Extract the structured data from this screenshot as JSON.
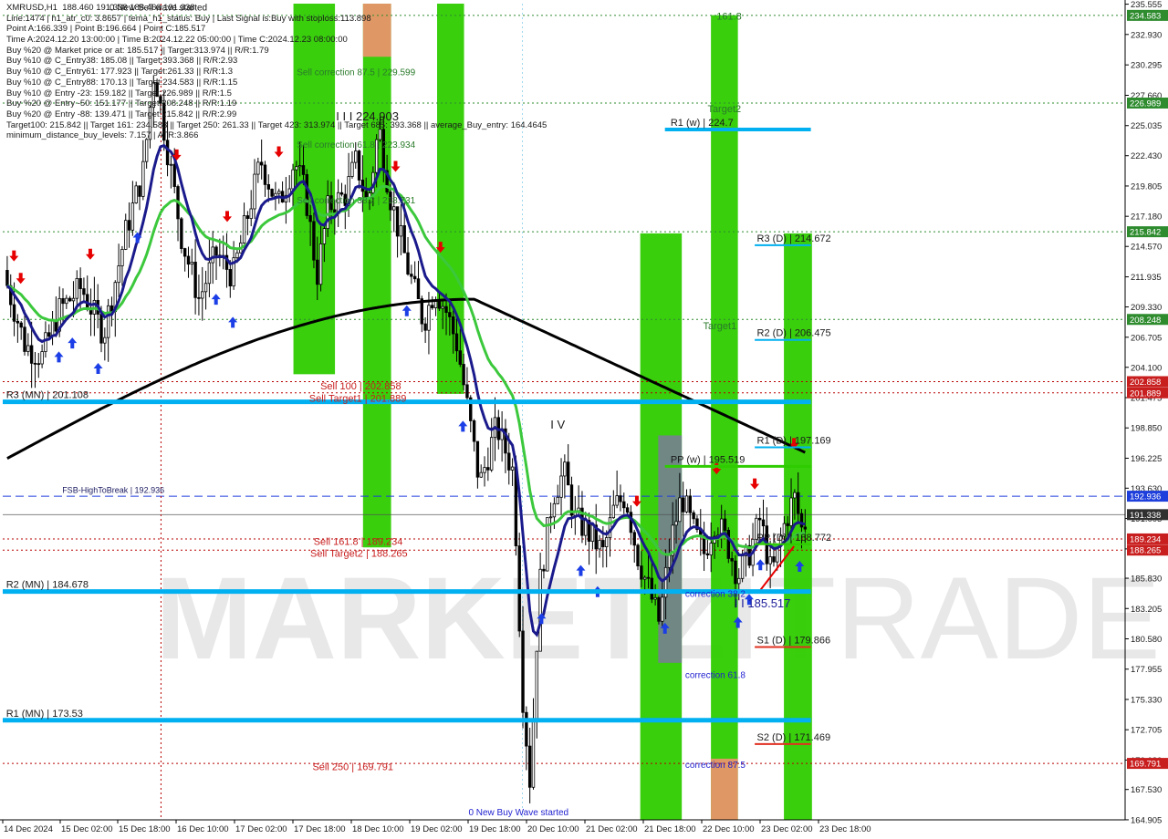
{
  "info_lines": [
    "XMRUSD,H1  188.460 191.338 188.460 191.338",
    "Line:1474 | h1_atr_c0: 3.8657 | tema_h1_status: Buy | Last Signal is:Buy with stoploss:113.898",
    "Point A:166.339 | Point B:196.664 | Point C:185.517",
    "Time A:2024.12.20 13:00:00 | Time B:2024.12.22 05:00:00 | Time C:2024.12.23 08:00:00",
    "Buy %20 @ Market price or at: 185.517 || Target:313.974 || R/R:1.79",
    "Buy %10 @ C_Entry38: 185.08 || Target:393.368 || R/R:2.93",
    "Buy %10 @ C_Entry61: 177.923 || Target:261.33 || R/R:1.3",
    "Buy %10 @ C_Entry88: 170.13 || Target:234.583 || R/R:1.15",
    "Buy %10 @ Entry -23: 159.182 || Target:226.989 || R/R:1.5",
    "Buy %20 @ Entry -50: 151.177 || Target:208.248 || R/R:1.19",
    "Buy %20 @ Entry -88: 139.471 || Target:215.842 || R/R:2.99",
    "Target100: 215.842 || Target 161: 234.583 || Target 250: 261.33 || Target 423: 313.974 || Target 685: 393.368 || average_Buy_entry: 164.4645",
    "minimum_distance_buy_levels: 7.157 | ATR:3.866"
  ],
  "watermark": {
    "left": "MARKETZI",
    "right": "TRADE"
  },
  "colors": {
    "green_zone": "#2ecc00",
    "orange_zone": "#e8956a",
    "pivot_blue": "#00b0f0",
    "ema_black": "#000000",
    "ema_navy": "#1a1a8c",
    "ema_green": "#3cc83c",
    "up_arrow": "#1b3ee6",
    "down_arrow": "#e60000",
    "red_dotted": "#b80000",
    "green_dotted": "#2a8a2a",
    "candle": "#000000"
  },
  "chart_data": {
    "type": "candlestick",
    "symbol": "XMRUSD",
    "timeframe": "H1",
    "ylim": [
      164.9,
      235.6
    ],
    "y_ticks": [
      "235.555",
      "232.930",
      "230.295",
      "227.660",
      "225.035",
      "222.430",
      "219.805",
      "217.180",
      "214.570",
      "211.935",
      "209.330",
      "206.705",
      "204.100",
      "201.475",
      "198.850",
      "196.225",
      "193.630",
      "191.005",
      "188.370",
      "185.830",
      "183.205",
      "180.580",
      "177.955",
      "175.330",
      "172.705",
      "170.080",
      "167.530",
      "164.905"
    ],
    "x_ticks": [
      "14 Dec 2024",
      "15 Dec 02:00",
      "15 Dec 18:00",
      "16 Dec 10:00",
      "17 Dec 02:00",
      "17 Dec 18:00",
      "18 Dec 10:00",
      "19 Dec 02:00",
      "19 Dec 18:00",
      "20 Dec 10:00",
      "21 Dec 02:00",
      "21 Dec 18:00",
      "22 Dec 10:00",
      "23 Dec 02:00",
      "23 Dec 18:00"
    ],
    "price_tags": [
      {
        "value": 234.583,
        "label": "234.583",
        "color": "#2e8b2e"
      },
      {
        "value": 226.989,
        "label": "226.989",
        "color": "#2e8b2e"
      },
      {
        "value": 215.842,
        "label": "215.842",
        "color": "#2e8b2e"
      },
      {
        "value": 208.248,
        "label": "208.248",
        "color": "#2e8b2e"
      },
      {
        "value": 202.858,
        "label": "202.858",
        "color": "#c81e1e"
      },
      {
        "value": 201.889,
        "label": "201.889",
        "color": "#c81e1e"
      },
      {
        "value": 192.936,
        "label": "192.936",
        "color": "#1f3fdc"
      },
      {
        "value": 191.338,
        "label": "191.338",
        "color": "#303030"
      },
      {
        "value": 189.234,
        "label": "189.234",
        "color": "#c81e1e"
      },
      {
        "value": 188.265,
        "label": "188.265",
        "color": "#c81e1e"
      },
      {
        "value": 169.791,
        "label": "169.791",
        "color": "#c81e1e"
      }
    ],
    "h_lines": [
      {
        "value": 201.108,
        "label": "R3 (MN) | 201.108",
        "x0": 0.0,
        "x1": 0.72,
        "label_x": 0.003,
        "color": "#00b0f0",
        "width": 5
      },
      {
        "value": 184.678,
        "label": "R2 (MN) | 184.678",
        "x0": 0.0,
        "x1": 0.72,
        "label_x": 0.003,
        "color": "#00b0f0",
        "width": 5
      },
      {
        "value": 173.53,
        "label": "R1 (MN) | 173.53",
        "x0": 0.0,
        "x1": 0.72,
        "label_x": 0.003,
        "color": "#00b0f0",
        "width": 5
      },
      {
        "value": 224.7,
        "label": "R1 (w) | 224.7",
        "x0": 0.59,
        "x1": 0.72,
        "label_x": 0.595,
        "color": "#00b0f0",
        "width": 4
      },
      {
        "value": 195.519,
        "label": "PP (w) | 195.519",
        "x0": 0.59,
        "x1": 0.72,
        "label_x": 0.595,
        "color": "#2ecc00",
        "width": 3
      },
      {
        "value": 214.672,
        "label": "R3 (D) | 214.672",
        "x0": 0.67,
        "x1": 0.72,
        "label_x": 0.672,
        "color": "#00b0f0",
        "width": 2
      },
      {
        "value": 206.475,
        "label": "R2 (D) | 206.475",
        "x0": 0.67,
        "x1": 0.72,
        "label_x": 0.672,
        "color": "#00b0f0",
        "width": 2
      },
      {
        "value": 197.169,
        "label": "R1 (D) | 197.169",
        "x0": 0.67,
        "x1": 0.72,
        "label_x": 0.672,
        "color": "#00b0f0",
        "width": 2
      },
      {
        "value": 188.772,
        "label": "PP (D) | 188.772",
        "x0": 0.67,
        "x1": 0.72,
        "label_x": 0.672,
        "color": "#2ecc00",
        "width": 2
      },
      {
        "value": 179.866,
        "label": "S1 (D) | 179.866",
        "x0": 0.67,
        "x1": 0.72,
        "label_x": 0.672,
        "color": "#e03020",
        "width": 2
      },
      {
        "value": 171.469,
        "label": "S2 (D) | 171.469",
        "x0": 0.67,
        "x1": 0.72,
        "label_x": 0.672,
        "color": "#e03020",
        "width": 2
      }
    ],
    "dashed_lines": [
      {
        "value": 192.936,
        "color": "#1f3fdc",
        "style": "dash"
      },
      {
        "value": 191.338,
        "color": "#505050",
        "style": "solid-thin"
      },
      {
        "value": 234.583,
        "color": "#2e8b2e",
        "style": "dot"
      },
      {
        "value": 226.989,
        "color": "#2e8b2e",
        "style": "dot"
      },
      {
        "value": 215.842,
        "color": "#2e8b2e",
        "style": "dot"
      },
      {
        "value": 208.248,
        "color": "#2e8b2e",
        "style": "dot"
      },
      {
        "value": 202.858,
        "color": "#b80000",
        "style": "dot"
      },
      {
        "value": 201.889,
        "color": "#b80000",
        "style": "dot"
      },
      {
        "value": 189.234,
        "color": "#b80000",
        "style": "dot"
      },
      {
        "value": 188.265,
        "color": "#b80000",
        "style": "dot"
      },
      {
        "value": 169.791,
        "color": "#b80000",
        "style": "dot"
      }
    ],
    "zones": [
      {
        "x0": 0.259,
        "x1": 0.296,
        "y0": 203.5,
        "y1": 235.6,
        "color": "#2ecc00"
      },
      {
        "x0": 0.321,
        "x1": 0.346,
        "y0": 188.5,
        "y1": 235.6,
        "color": "#2ecc00"
      },
      {
        "x0": 0.321,
        "x1": 0.346,
        "y0": 231.0,
        "y1": 235.6,
        "color": "#e8956a"
      },
      {
        "x0": 0.387,
        "x1": 0.411,
        "y0": 201.8,
        "y1": 235.6,
        "color": "#2ecc00"
      },
      {
        "x0": 0.568,
        "x1": 0.605,
        "y0": 164.9,
        "y1": 215.7,
        "color": "#2ecc00"
      },
      {
        "x0": 0.584,
        "x1": 0.605,
        "y0": 178.5,
        "y1": 198.2,
        "color": "#7a7a9a"
      },
      {
        "x0": 0.631,
        "x1": 0.655,
        "y0": 164.9,
        "y1": 234.6,
        "color": "#2ecc00"
      },
      {
        "x0": 0.631,
        "x1": 0.655,
        "y0": 164.9,
        "y1": 170.2,
        "color": "#e8956a"
      },
      {
        "x0": 0.696,
        "x1": 0.721,
        "y0": 164.9,
        "y1": 215.7,
        "color": "#2ecc00"
      }
    ],
    "labels": [
      {
        "text": "Sell correction 87.5 | 229.599",
        "x": 0.262,
        "value": 229.4,
        "color": "#2a7a2a",
        "size": 10
      },
      {
        "text": "I I I 224.903",
        "x": 0.297,
        "value": 225.5,
        "color": "#1a1a1a",
        "size": 13
      },
      {
        "text": "Sell correction 61.8 | 223.934",
        "x": 0.262,
        "value": 223.1,
        "color": "#2a7a2a",
        "size": 10
      },
      {
        "text": "Sell correction 38.2 | 218.731",
        "x": 0.262,
        "value": 218.3,
        "color": "#2a7a2a",
        "size": 10
      },
      {
        "text": "Sell 100 | 202.858",
        "x": 0.283,
        "value": 202.2,
        "color": "#c81e1e",
        "size": 11
      },
      {
        "text": "Sell Target1 | 201.889",
        "x": 0.273,
        "value": 201.1,
        "color": "#c81e1e",
        "size": 11
      },
      {
        "text": "FSB-HighToBreak | 192.936",
        "x": 0.053,
        "value": 193.2,
        "color": "#1a1a60",
        "size": 9
      },
      {
        "text": "Sell 161.8 | 189.234",
        "x": 0.277,
        "value": 188.7,
        "color": "#c81e1e",
        "size": 11
      },
      {
        "text": "Sell Target2 | 188.265",
        "x": 0.274,
        "value": 187.7,
        "color": "#c81e1e",
        "size": 11
      },
      {
        "text": "Sell 250 | 169.791",
        "x": 0.276,
        "value": 169.2,
        "color": "#c81e1e",
        "size": 11
      },
      {
        "text": "0 New Buy Wave started",
        "x": 0.415,
        "value": 165.3,
        "color": "#1f1fd0",
        "size": 10
      },
      {
        "text": "0 New Sell wave started",
        "x": 0.095,
        "value": 235.0,
        "color": "#1a1a1a",
        "size": 10
      },
      {
        "text": "I V",
        "x": 0.488,
        "value": 198.8,
        "color": "#1a1a1a",
        "size": 13
      },
      {
        "text": "161.8",
        "x": 0.636,
        "value": 234.2,
        "color": "#2a7a2a",
        "size": 11
      },
      {
        "text": "Target2",
        "x": 0.628,
        "value": 226.2,
        "color": "#2a7a2a",
        "size": 11
      },
      {
        "text": "Target1",
        "x": 0.624,
        "value": 207.4,
        "color": "#2a7a2a",
        "size": 11
      },
      {
        "text": "correction 38.2",
        "x": 0.608,
        "value": 184.2,
        "color": "#1f1fd0",
        "size": 10
      },
      {
        "text": "I I 185.517",
        "x": 0.652,
        "value": 183.3,
        "color": "#1a1a9a",
        "size": 13
      },
      {
        "text": "correction 61.8",
        "x": 0.608,
        "value": 177.2,
        "color": "#1f1fd0",
        "size": 10
      },
      {
        "text": "correction 87.5",
        "x": 0.608,
        "value": 169.4,
        "color": "#1f1fd0",
        "size": 10
      }
    ]
  }
}
